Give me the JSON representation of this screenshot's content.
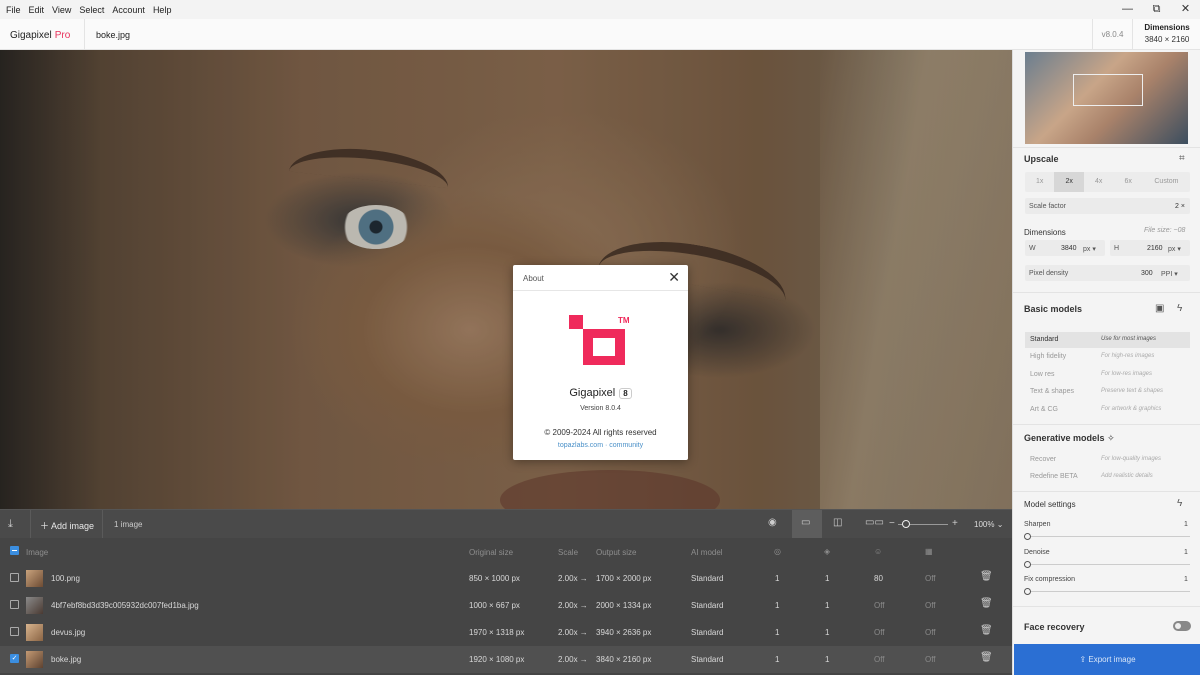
{
  "menu": [
    "File",
    "Edit",
    "View",
    "Select",
    "Account",
    "Help"
  ],
  "window_controls": {
    "minimize": "—",
    "restore": "⧉",
    "close": "✕"
  },
  "header": {
    "brand": "Gigapixel",
    "brand_tag": "Pro",
    "file": "boke.jpg",
    "version": "v8.0.4",
    "dims_label": "Dimensions",
    "dims_value": "3840 × 2160"
  },
  "about": {
    "title": "About",
    "app": "Gigapixel",
    "major": "8",
    "version": "Version 8.0.4",
    "copyright": "© 2009-2024 All rights reserved",
    "links": "topazlabs.com · community",
    "tm": "TM"
  },
  "toolbar": {
    "add": "Add image",
    "count": "1 image",
    "zoom": "100%"
  },
  "table": {
    "headers": {
      "image": "Image",
      "orig": "Original size",
      "scale": "Scale",
      "out": "Output size",
      "model": "AI model"
    },
    "rows": [
      {
        "name": "100.png",
        "orig": "850 × 1000 px",
        "scale": "2.00x →",
        "out": "1700 × 2000 px",
        "model": "Standard",
        "c1": "1",
        "c2": "1",
        "c3": "80",
        "c4": "Off",
        "checked": false
      },
      {
        "name": "4bf7ebf8bd3d39c005932dc007fed1ba.jpg",
        "orig": "1000 × 667 px",
        "scale": "2.00x →",
        "out": "2000 × 1334 px",
        "model": "Standard",
        "c1": "1",
        "c2": "1",
        "c3": "Off",
        "c4": "Off",
        "checked": false
      },
      {
        "name": "devus.jpg",
        "orig": "1970 × 1318 px",
        "scale": "2.00x →",
        "out": "3940 × 2636 px",
        "model": "Standard",
        "c1": "1",
        "c2": "1",
        "c3": "Off",
        "c4": "Off",
        "checked": false
      },
      {
        "name": "boke.jpg",
        "orig": "1920 × 1080 px",
        "scale": "2.00x →",
        "out": "3840 × 2160 px",
        "model": "Standard",
        "c1": "1",
        "c2": "1",
        "c3": "Off",
        "c4": "Off",
        "checked": true
      }
    ]
  },
  "side": {
    "upscale": "Upscale",
    "scales": [
      "1x",
      "2x",
      "4x",
      "6x",
      "Custom"
    ],
    "scale_factor_label": "Scale factor",
    "scale_factor_value": "2 ×",
    "dimensions": "Dimensions",
    "file_size": "File size: ~08",
    "w_label": "W",
    "w_value": "3840",
    "w_unit": "px ▾",
    "h_label": "H",
    "h_value": "2160",
    "h_unit": "px ▾",
    "density_label": "Pixel density",
    "density_value": "300",
    "density_unit": "PPI ▾",
    "basic_models": "Basic models",
    "models": [
      {
        "name": "Standard",
        "desc": "Use for most images"
      },
      {
        "name": "High fidelity",
        "desc": "For high-res images"
      },
      {
        "name": "Low res",
        "desc": "For low-res images"
      },
      {
        "name": "Text & shapes",
        "desc": "Preserve text & shapes"
      },
      {
        "name": "Art & CG",
        "desc": "For artwork & graphics"
      }
    ],
    "generative_models": "Generative models",
    "gen_models": [
      {
        "name": "Recover",
        "desc": "For low-quality images"
      },
      {
        "name": "Redefine BETA",
        "desc": "Add realistic details"
      }
    ],
    "model_settings": "Model settings",
    "sharpen": "Sharpen",
    "sharpen_v": "1",
    "denoise": "Denoise",
    "denoise_v": "1",
    "fix": "Fix compression",
    "fix_v": "1",
    "face": "Face recovery",
    "export": "Export image"
  }
}
